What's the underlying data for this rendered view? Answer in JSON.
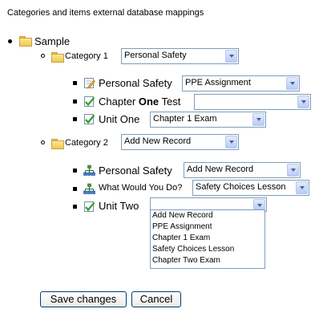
{
  "heading": "Categories and items external database mappings",
  "tree": {
    "root_label": "Sample",
    "categories": [
      {
        "label": "Category 1",
        "select_value": "Personal Safety",
        "items": [
          {
            "label": "Personal Safety",
            "icon": "edit-document-icon",
            "select_value": "PPE Assignment"
          },
          {
            "label_parts": [
              "Chapter ",
              "One",
              " Test"
            ],
            "icon": "checked-document-icon",
            "select_value": ""
          },
          {
            "label": "Unit One",
            "icon": "checked-document-icon",
            "select_value": "Chapter 1 Exam"
          }
        ]
      },
      {
        "label": "Category 2",
        "select_value": "Add New Record",
        "items": [
          {
            "label": "Personal Safety",
            "icon": "hierarchy-icon",
            "select_value": "Add New Record"
          },
          {
            "label": "What Would You Do?",
            "icon": "hierarchy-icon",
            "select_value": "Safety Choices Lesson"
          },
          {
            "label": "Unit Two",
            "icon": "checked-document-icon",
            "select_value": "",
            "dropdown_open": true
          }
        ]
      }
    ]
  },
  "dropdown_options": [
    "Add New Record",
    "PPE Assignment",
    "Chapter 1 Exam",
    "Safety Choices Lesson",
    "Chapter Two Exam"
  ],
  "buttons": {
    "save": "Save changes",
    "cancel": "Cancel"
  }
}
